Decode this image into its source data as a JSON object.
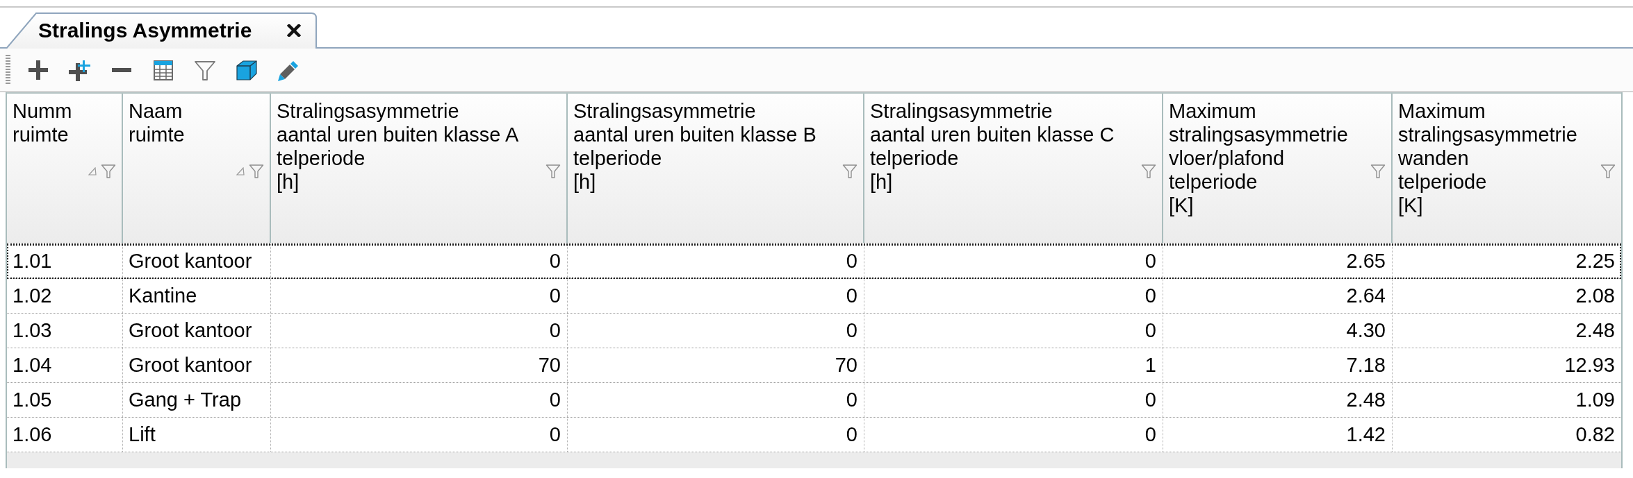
{
  "tab": {
    "title": "Stralings Asymmetrie",
    "selected": true
  },
  "table": {
    "columns": [
      {
        "lines": [
          "Numm",
          "ruimte"
        ],
        "kind": "text",
        "sort_indicator": true
      },
      {
        "lines": [
          "Naam",
          "ruimte"
        ],
        "kind": "text",
        "sort_indicator": true
      },
      {
        "lines": [
          "Stralingsasymmetrie",
          "aantal uren buiten klasse A",
          "telperiode",
          "[h]"
        ],
        "kind": "number",
        "sort_indicator": false
      },
      {
        "lines": [
          "Stralingsasymmetrie",
          "aantal uren buiten klasse B",
          "telperiode",
          "[h]"
        ],
        "kind": "number",
        "sort_indicator": false
      },
      {
        "lines": [
          "Stralingsasymmetrie",
          "aantal uren buiten klasse C",
          "telperiode",
          "[h]"
        ],
        "kind": "number",
        "sort_indicator": false
      },
      {
        "lines": [
          "Maximum",
          "stralingsasymmetrie",
          "vloer/plafond",
          "telperiode",
          "[K]"
        ],
        "kind": "number",
        "sort_indicator": false
      },
      {
        "lines": [
          "Maximum",
          "stralingsasymmetrie",
          "wanden",
          "telperiode",
          "[K]"
        ],
        "kind": "number",
        "sort_indicator": false
      }
    ],
    "rows": [
      {
        "cells": [
          "1.01",
          "Groot kantoor",
          "0",
          "0",
          "0",
          "2.65",
          "2.25"
        ],
        "selected": true
      },
      {
        "cells": [
          "1.02",
          "Kantine",
          "0",
          "0",
          "0",
          "2.64",
          "2.08"
        ],
        "selected": false
      },
      {
        "cells": [
          "1.03",
          "Groot kantoor",
          "0",
          "0",
          "0",
          "4.30",
          "2.48"
        ],
        "selected": false
      },
      {
        "cells": [
          "1.04",
          "Groot kantoor",
          "70",
          "70",
          "1",
          "7.18",
          "12.93"
        ],
        "selected": false
      },
      {
        "cells": [
          "1.05",
          "Gang + Trap",
          "0",
          "0",
          "0",
          "2.48",
          "1.09"
        ],
        "selected": false
      },
      {
        "cells": [
          "1.06",
          "Lift",
          "0",
          "0",
          "0",
          "1.42",
          "0.82"
        ],
        "selected": false
      }
    ]
  }
}
